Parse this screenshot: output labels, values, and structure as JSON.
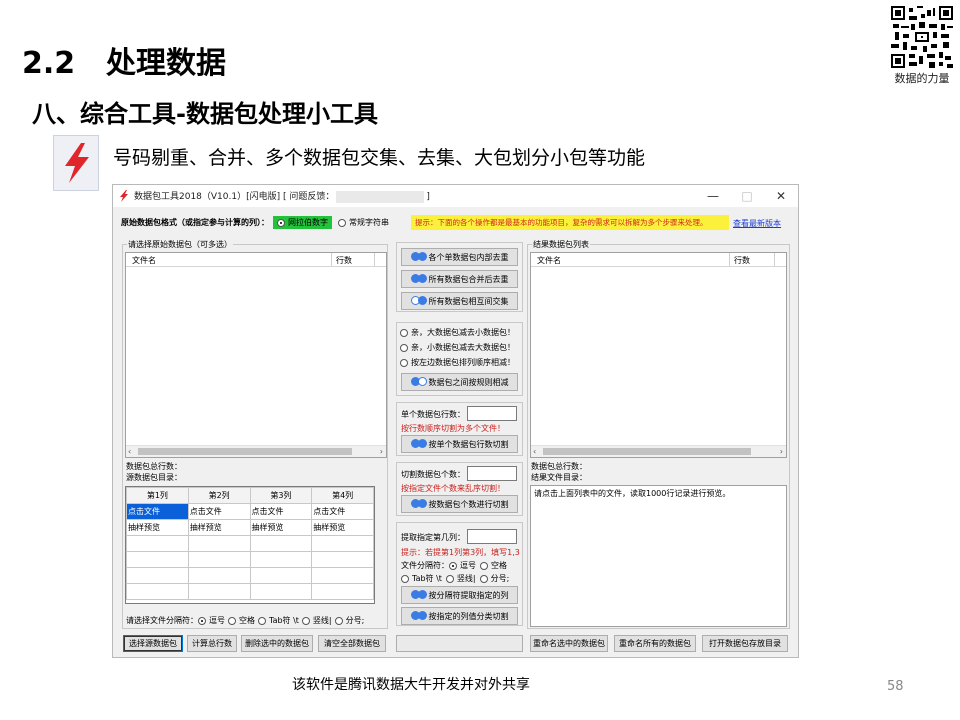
{
  "slide": {
    "section_number": "2.2",
    "section_title": "处理数据",
    "subtitle": "八、综合工具-数据包处理小工具",
    "description": "号码剔重、合并、多个数据包交集、去集、大包划分小包等功能",
    "qr_caption": "数据的力量",
    "footer_note": "该软件是腾讯数据大牛开发并对外共享",
    "page_number": "58"
  },
  "window": {
    "title_prefix": "数据包工具2018（V10.1）[闪电版]  [ 问题反馈：",
    "title_suffix": "]",
    "minimize": "—",
    "maximize": "□",
    "close": "✕"
  },
  "format_bar": {
    "label": "原始数据包格式（或指定参与计算的列）：",
    "option_number": "网拉伯数字",
    "option_string": "常规字符串",
    "tip": "提示：下面的各个操作都是最基本的功能项目，复杂的需求可以拆解为多个步骤来处理。",
    "new_version_link": "查看最新版本"
  },
  "left": {
    "group_title": "请选择原始数据包（可多选）",
    "col_filename": "文件名",
    "col_rows": "行数",
    "total_rows_label": "数据包总行数：",
    "source_dir_label": "源数据包目录：",
    "grid_headers": [
      "第1列",
      "第2列",
      "第3列",
      "第4列"
    ],
    "grid_rows": [
      [
        "点击文件",
        "点击文件",
        "点击文件",
        "点击文件"
      ],
      [
        "抽样预览",
        "抽样预览",
        "抽样预览",
        "抽样预览"
      ],
      [
        "",
        "",
        "",
        ""
      ],
      [
        "",
        "",
        "",
        ""
      ],
      [
        "",
        "",
        "",
        ""
      ],
      [
        "",
        "",
        "",
        ""
      ]
    ],
    "separator_label": "请选择文件分隔符：",
    "sep_comma": "逗号",
    "sep_space": "空格",
    "sep_tab": "Tab符 \\t",
    "sep_pipe": "竖线|",
    "sep_semicolon": "分号;"
  },
  "middle": {
    "btn_dedup_each": "各个单数据包内部去重",
    "btn_merge_dedup": "所有数据包合并后去重",
    "btn_intersect": "所有数据包相互间交集",
    "opt_big_minus_small": "亲，大数据包减去小数据包！",
    "opt_small_minus_big": "亲，小数据包减去大数据包！",
    "opt_left_order": "按左边数据包排列顺序相减！",
    "btn_subtract": "数据包之间按规则相减",
    "single_rows_label": "单个数据包行数：",
    "single_rows_hint": "按行数顺序切割为多个文件！",
    "btn_cut_rows": "按单个数据包行数切割",
    "cut_count_label": "切割数据包个数：",
    "cut_count_hint": "按指定文件个数来乱序切割！",
    "btn_cut_count": "按数据包个数进行切割",
    "extract_col_label": "提取指定第几列：",
    "extract_hint": "提示：若提第1列第3列，填写1,3",
    "file_sep_label": "文件分隔符：",
    "sep_comma": "逗号",
    "sep_space": "空格",
    "sep_tab": "Tab符 \\t",
    "sep_pipe": "竖线|",
    "sep_semicolon": "分号;",
    "btn_extract": "按分隔符提取指定的列",
    "btn_classify": "按指定的列值分类切割"
  },
  "right": {
    "group_title": "结果数据包列表",
    "col_filename": "文件名",
    "col_rows": "行数",
    "total_rows_label": "数据包总行数：",
    "result_dir_label": "结果文件目录：",
    "preview_text": "请点击上面列表中的文件，读取1000行记录进行预览。"
  },
  "bottom_buttons": {
    "select_source": "选择源数据包",
    "count_rows": "计算总行数",
    "delete_selected": "删除选中的数据包",
    "clear_all": "清空全部数据包",
    "rename_selected": "重命名选中的数据包",
    "rename_all": "重命名所有的数据包",
    "open_folder": "打开数据包存放目录"
  },
  "colors": {
    "accent_red": "#e0262b",
    "selection_blue": "#0a60d8",
    "tip_yellow": "#fbf13b",
    "option_green": "#22c33a"
  }
}
